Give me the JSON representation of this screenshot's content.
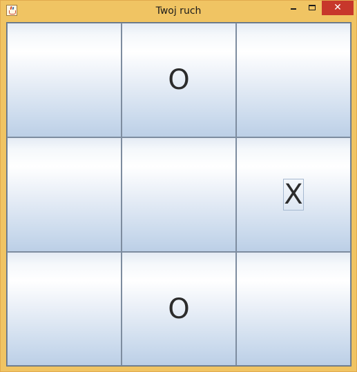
{
  "window": {
    "title": "Twoj ruch",
    "icon": "java-cup-icon",
    "controls": {
      "minimize_glyph": "",
      "maximize_glyph": "",
      "close_glyph": "✕"
    },
    "close_color": "#c7372b",
    "frame_color": "#f0c463"
  },
  "board": {
    "cells": [
      {
        "mark": ""
      },
      {
        "mark": "O"
      },
      {
        "mark": ""
      },
      {
        "mark": ""
      },
      {
        "mark": ""
      },
      {
        "mark": "X",
        "focused": true
      },
      {
        "mark": ""
      },
      {
        "mark": "O"
      },
      {
        "mark": ""
      }
    ]
  }
}
